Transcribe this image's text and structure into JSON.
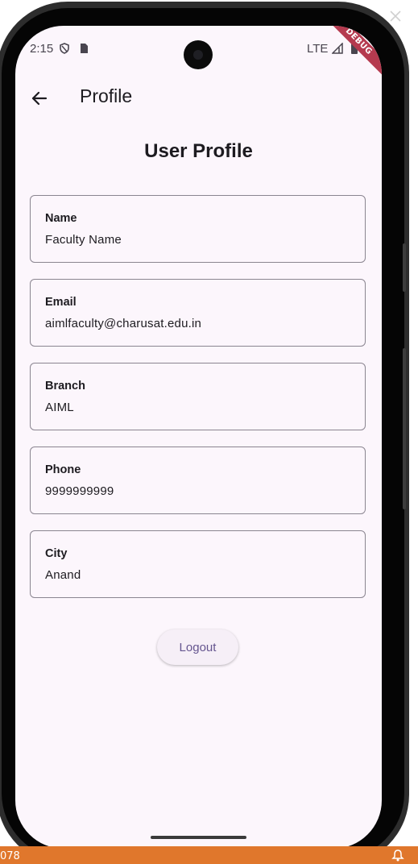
{
  "status_bar": {
    "time": "2:15",
    "network": "LTE",
    "debug_banner": "DEBUG"
  },
  "app_bar": {
    "title": "Profile",
    "back_icon": "arrow-left-icon"
  },
  "page": {
    "heading": "User Profile"
  },
  "fields": [
    {
      "label": "Name",
      "value": "Faculty Name"
    },
    {
      "label": "Email",
      "value": "aimlfaculty@charusat.edu.in"
    },
    {
      "label": "Branch",
      "value": "AIML"
    },
    {
      "label": "Phone",
      "value": "9999999999"
    },
    {
      "label": "City",
      "value": "Anand"
    }
  ],
  "actions": {
    "logout_label": "Logout"
  },
  "host_taskbar": {
    "left_text": "078"
  },
  "colors": {
    "screen_background": "#fcf6fc",
    "accent": "#65558f",
    "debug_ribbon": "#b53a4f",
    "taskbar": "#e0772c"
  }
}
